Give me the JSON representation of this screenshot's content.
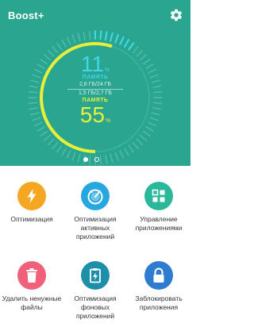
{
  "header": {
    "title": "Boost+",
    "settings_icon": "gear-icon"
  },
  "dial": {
    "storage": {
      "value": "11",
      "unit": "%",
      "label": "ПАМЯТЬ",
      "detail": "2,6 ГБ/24 ГБ",
      "fraction": 0.11
    },
    "memory": {
      "value": "55",
      "unit": "%",
      "label": "ПАМЯТЬ",
      "detail": "1,5 ГБ/2,7 ГБ",
      "fraction": 0.55
    },
    "colors": {
      "storage": "#3fd6e8",
      "memory": "#e8ef3a",
      "track": "#56bcaa"
    }
  },
  "pager": {
    "pages": 2,
    "active": 1
  },
  "actions": [
    {
      "label": "Оптимизация",
      "icon": "lightning-icon",
      "color": "#f5a623"
    },
    {
      "label": "Оптимизация активных приложений",
      "icon": "gauge-icon",
      "color": "#27a7df"
    },
    {
      "label": "Управление приложениями",
      "icon": "app-grid-icon",
      "color": "#2bb89a"
    },
    {
      "label": "Удалить ненужные файлы",
      "icon": "trash-icon",
      "color": "#f0607a"
    },
    {
      "label": "Оптимизация фоновых приложений",
      "icon": "clipboard-icon",
      "color": "#1e8fa8"
    },
    {
      "label": "Заблокировать приложения",
      "icon": "lock-icon",
      "color": "#2e7bd0"
    }
  ]
}
